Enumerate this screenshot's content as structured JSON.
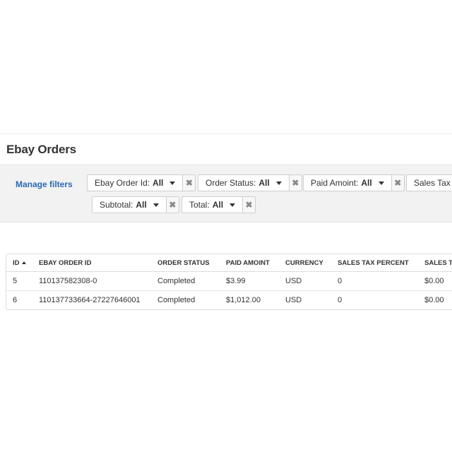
{
  "page": {
    "title": "Ebay Orders"
  },
  "filters": {
    "manage_label": "Manage filters",
    "chips": [
      {
        "label": "Ebay Order Id:",
        "value": "All"
      },
      {
        "label": "Order Status:",
        "value": "All"
      },
      {
        "label": "Paid Amoint:",
        "value": "All"
      },
      {
        "label": "Sales Tax A",
        "value": ""
      },
      {
        "label": "Subtotal:",
        "value": "All"
      },
      {
        "label": "Total:",
        "value": "All"
      }
    ],
    "remove_glyph": "✖"
  },
  "table": {
    "columns": [
      "ID",
      "EBAY ORDER ID",
      "ORDER STATUS",
      "PAID AMOINT",
      "CURRENCY",
      "SALES TAX PERCENT",
      "SALES T"
    ],
    "sort": {
      "column": "ID",
      "direction": "ascending"
    },
    "rows": [
      [
        "5",
        "110137582308-0",
        "Completed",
        "$3.99",
        "USD",
        "0",
        "$0.00"
      ],
      [
        "6",
        "110137733664-27227646001",
        "Completed",
        "$1,012.00",
        "USD",
        "0",
        "$0.00"
      ]
    ]
  },
  "colors": {
    "link": "#2a6ab3",
    "filter_bar_bg": "#f2f2f2",
    "border": "#dcdcdc"
  }
}
